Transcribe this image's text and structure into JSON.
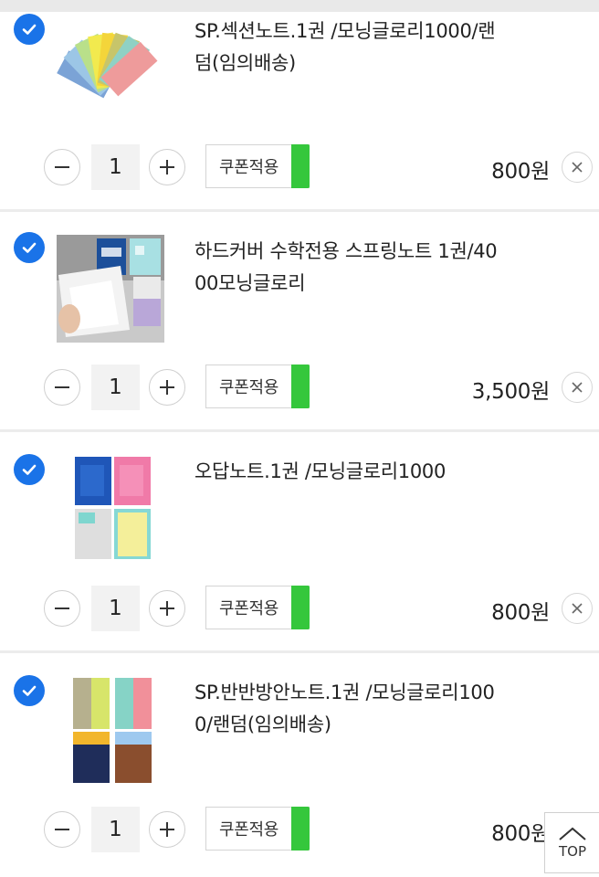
{
  "cart": {
    "items": [
      {
        "title_line1": "SP.섹션노트.1권 /모닝글로리1000/랜",
        "title_line2": "덤(임의배송)",
        "quantity": "1",
        "coupon_label": "쿠폰적용",
        "price": "800원",
        "checked": true,
        "image_name": "section-notes-fan-image"
      },
      {
        "title_line1": "하드커버 수학전용 스프링노트 1권/40",
        "title_line2": "00모닝글로리",
        "quantity": "1",
        "coupon_label": "쿠폰적용",
        "price": "3,500원",
        "checked": true,
        "image_name": "hardcover-math-spring-notes-image"
      },
      {
        "title_line1": "오답노트.1권 /모닝글로리1000",
        "title_line2": "",
        "quantity": "1",
        "coupon_label": "쿠폰적용",
        "price": "800원",
        "checked": true,
        "image_name": "wrong-answer-notes-image"
      },
      {
        "title_line1": "SP.반반방안노트.1권 /모닝글로리100",
        "title_line2": "0/랜덤(임의배송)",
        "quantity": "1",
        "coupon_label": "쿠폰적용",
        "price": "800원",
        "checked": true,
        "image_name": "half-grid-notes-image"
      }
    ]
  },
  "scroll_top": {
    "label": "TOP"
  },
  "colors": {
    "checkbox": "#1a73e8",
    "coupon_accent": "#35c73c",
    "divider": "#ececec"
  }
}
